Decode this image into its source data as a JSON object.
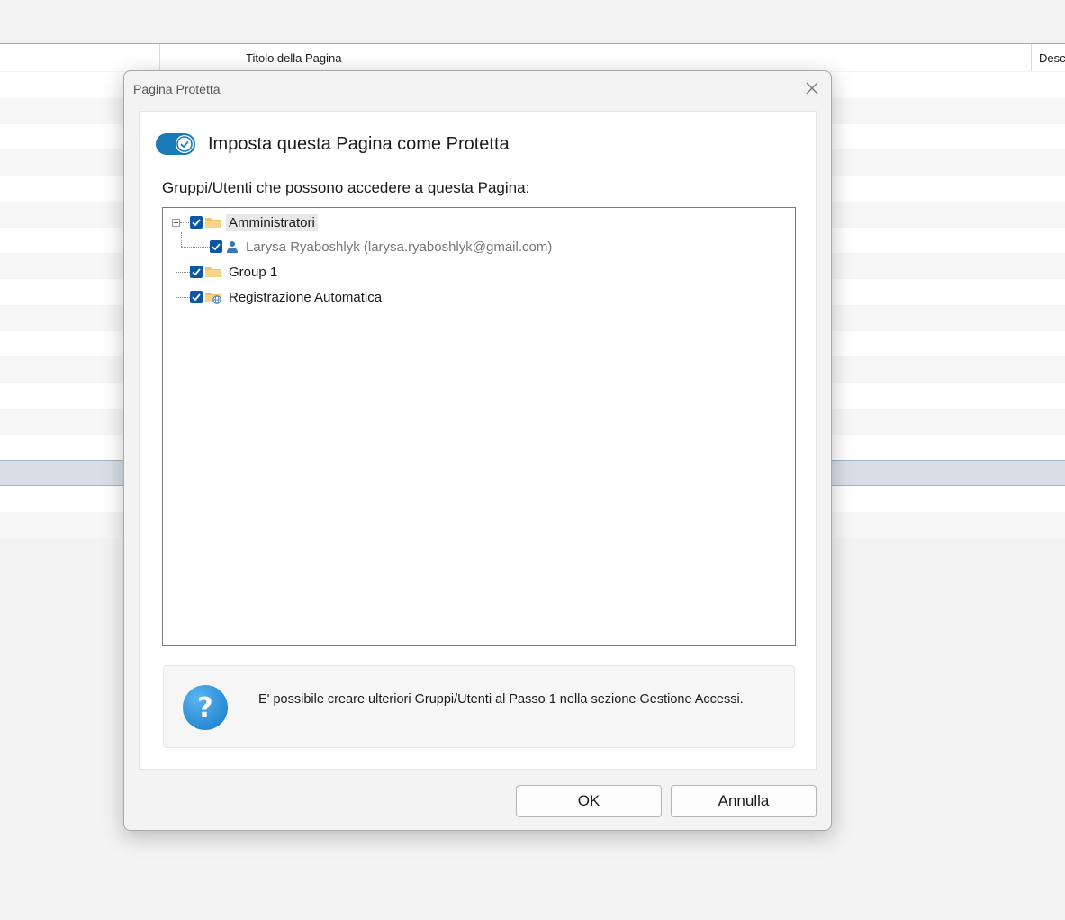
{
  "background": {
    "column_title": "Titolo della Pagina",
    "column_desc": "Desc"
  },
  "dialog": {
    "title": "Pagina Protetta",
    "toggle": {
      "label": "Imposta questa Pagina come Protetta",
      "checked": true
    },
    "access_label": "Gruppi/Utenti che possono accedere a questa Pagina:",
    "tree": {
      "nodes": [
        {
          "label": "Amministratori",
          "checked": true,
          "icon": "folder-icon"
        },
        {
          "label": "Larysa Ryaboshlyk (larysa.ryaboshlyk@gmail.com)",
          "checked": true,
          "icon": "user-icon"
        },
        {
          "label": "Group 1",
          "checked": true,
          "icon": "folder-icon"
        },
        {
          "label": "Registrazione Automatica",
          "checked": true,
          "icon": "folder-globe-icon"
        }
      ]
    },
    "info": {
      "icon": "help-icon",
      "text": "E' possibile creare ulteriori Gruppi/Utenti al Passo 1 nella sezione Gestione Accessi."
    },
    "ok_label": "OK",
    "cancel_label": "Annulla"
  },
  "colors": {
    "accent": "#1a7ab8",
    "checkbox": "#0b57a4",
    "folder": "#f2c36b"
  }
}
